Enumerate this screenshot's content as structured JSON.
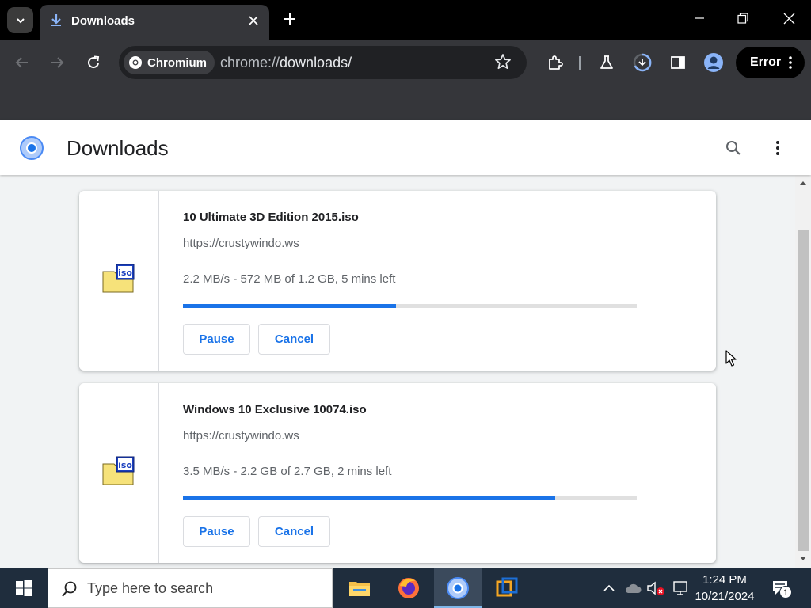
{
  "browser": {
    "tab": {
      "title": "Downloads"
    },
    "omnibox": {
      "site_chip": "Chromium",
      "url_scheme": "chrome://",
      "url_rest": "downloads/"
    },
    "profile_status": "Error",
    "colors": {
      "chrome_dark": "#35363a",
      "tabstrip": "#000000",
      "accent_blue": "#1a73e8"
    }
  },
  "page": {
    "title": "Downloads",
    "downloads": [
      {
        "file_name": "10 Ultimate 3D Edition 2015.iso",
        "url": "https://crustywindo.ws",
        "status": "2.2 MB/s - 572 MB of 1.2 GB, 5 mins left",
        "progress_percent": 47,
        "pause_label": "Pause",
        "cancel_label": "Cancel",
        "icon": "iso-file-icon"
      },
      {
        "file_name": "Windows 10 Exclusive 10074.iso",
        "url": "https://crustywindo.ws",
        "status": "3.5 MB/s - 2.2 GB of 2.7 GB, 2 mins left",
        "progress_percent": 82,
        "pause_label": "Pause",
        "cancel_label": "Cancel",
        "icon": "iso-file-icon"
      }
    ]
  },
  "taskbar": {
    "search_placeholder": "Type here to search",
    "time": "1:24 PM",
    "date": "10/21/2024",
    "notification_count": "1",
    "apps": [
      "file-explorer-icon",
      "firefox-icon",
      "chromium-icon",
      "virtualbox-icon"
    ]
  }
}
